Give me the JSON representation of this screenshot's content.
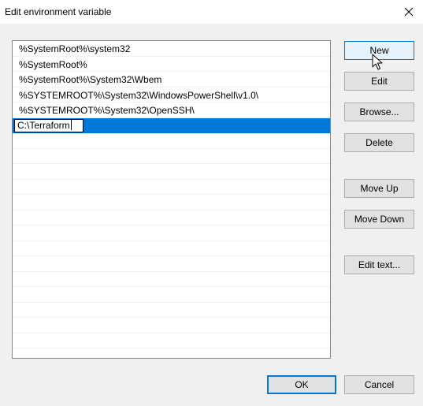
{
  "window": {
    "title": "Edit environment variable",
    "close_icon": "close-icon"
  },
  "path_list": {
    "items": [
      "%SystemRoot%\\system32",
      "%SystemRoot%",
      "%SystemRoot%\\System32\\Wbem",
      "%SYSTEMROOT%\\System32\\WindowsPowerShell\\v1.0\\",
      "%SYSTEMROOT%\\System32\\OpenSSH\\"
    ],
    "editing_value": "C:\\Terraform"
  },
  "buttons": {
    "new": "New",
    "edit": "Edit",
    "browse": "Browse...",
    "delete": "Delete",
    "move_up": "Move Up",
    "move_down": "Move Down",
    "edit_text": "Edit text...",
    "ok": "OK",
    "cancel": "Cancel"
  },
  "colors": {
    "selection": "#0078d7",
    "accent": "#0078d7",
    "dialog_background": "#f0f0f0"
  }
}
